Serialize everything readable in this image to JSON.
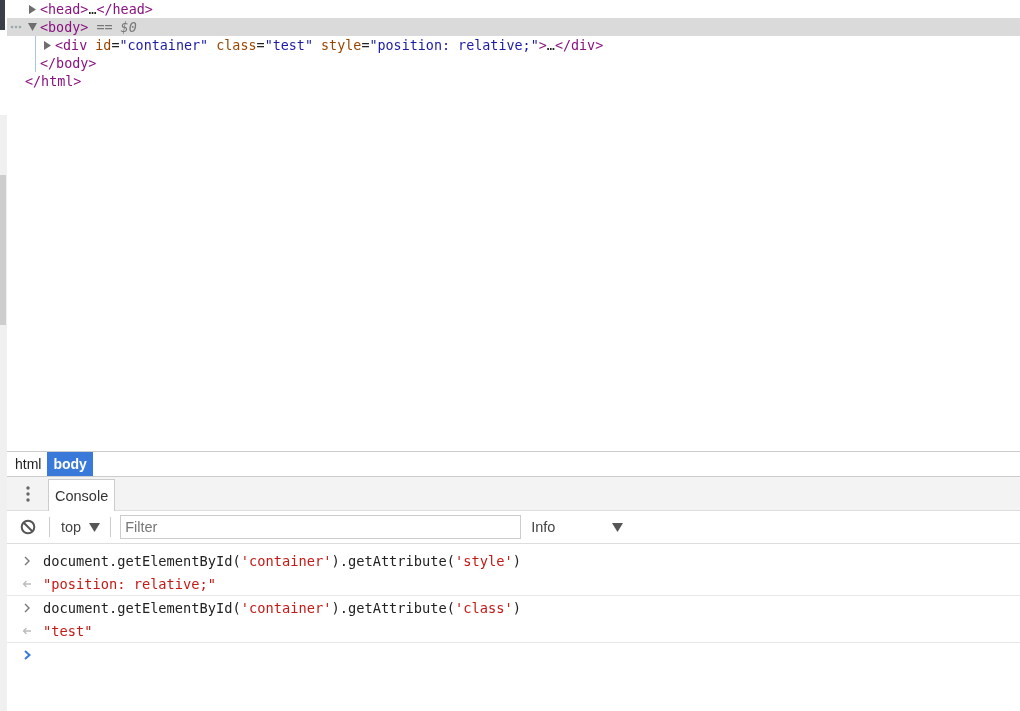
{
  "elements_panel": {
    "root_closing": [
      {
        "kind": "tag",
        "text": "</html>"
      }
    ],
    "nodes": [
      {
        "expanded": false,
        "selected": false,
        "line": [
          {
            "kind": "tag",
            "text": "<head>"
          },
          {
            "kind": "text",
            "text": "…"
          },
          {
            "kind": "tag",
            "text": "</head>"
          }
        ]
      },
      {
        "expanded": true,
        "selected": true,
        "line": [
          {
            "kind": "tag",
            "text": "<body>"
          },
          {
            "kind": "marker",
            "text": " == $0"
          }
        ],
        "children": [
          {
            "expanded": false,
            "selected": false,
            "line": [
              {
                "kind": "tag",
                "text": "<div"
              },
              {
                "kind": "attr",
                "text": " id"
              },
              {
                "kind": "punct",
                "text": "="
              },
              {
                "kind": "value",
                "text": "\"container\""
              },
              {
                "kind": "attr",
                "text": " class"
              },
              {
                "kind": "punct",
                "text": "="
              },
              {
                "kind": "value",
                "text": "\"test\""
              },
              {
                "kind": "attr",
                "text": " style"
              },
              {
                "kind": "punct",
                "text": "="
              },
              {
                "kind": "value",
                "text": "\"position: relative;\""
              },
              {
                "kind": "tag",
                "text": ">"
              },
              {
                "kind": "text",
                "text": "…"
              },
              {
                "kind": "tag",
                "text": "</div>"
              }
            ]
          }
        ],
        "closing": [
          {
            "kind": "tag",
            "text": "</body>"
          }
        ]
      }
    ]
  },
  "breadcrumbs": [
    {
      "label": "html",
      "selected": false
    },
    {
      "label": "body",
      "selected": true
    }
  ],
  "drawer_tabs": [
    {
      "label": "Console",
      "selected": true
    }
  ],
  "console_toolbar": {
    "context": "top",
    "filter": {
      "placeholder": "Filter"
    },
    "level": "Info"
  },
  "console_messages": [
    {
      "kind": "input",
      "segments": [
        {
          "kind": "code",
          "text": "document.getElementById("
        },
        {
          "kind": "string",
          "text": "'container'"
        },
        {
          "kind": "code",
          "text": ").getAttribute("
        },
        {
          "kind": "string",
          "text": "'style'"
        },
        {
          "kind": "code",
          "text": ")"
        }
      ]
    },
    {
      "kind": "output",
      "segments": [
        {
          "kind": "string",
          "text": "\"position: relative;\""
        }
      ]
    },
    {
      "kind": "input",
      "segments": [
        {
          "kind": "code",
          "text": "document.getElementById("
        },
        {
          "kind": "string",
          "text": "'container'"
        },
        {
          "kind": "code",
          "text": ").getAttribute("
        },
        {
          "kind": "string",
          "text": "'class'"
        },
        {
          "kind": "code",
          "text": ")"
        }
      ]
    },
    {
      "kind": "output",
      "segments": [
        {
          "kind": "string",
          "text": "\"test\""
        }
      ]
    },
    {
      "kind": "prompt"
    }
  ]
}
